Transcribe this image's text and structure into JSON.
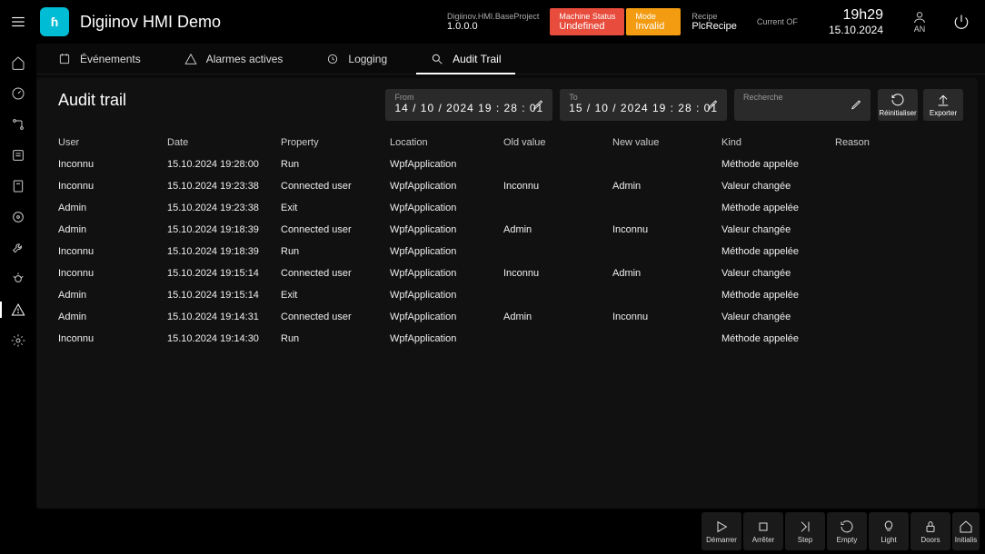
{
  "header": {
    "app_title": "Digiinov HMI Demo",
    "project_label": "Digiinov.HMI.BaseProject",
    "project_version": "1.0.0.0",
    "machine_status_label": "Machine Status",
    "machine_status_value": "Undefined",
    "mode_label": "Mode",
    "mode_value": "Invalid",
    "recipe_label": "Recipe",
    "recipe_value": "PlcRecipe",
    "current_of_label": "Current OF",
    "current_of_value": "",
    "time": "19h29",
    "date": "15.10.2024",
    "user": "AN"
  },
  "tabs": {
    "events": "Événements",
    "alarms": "Alarmes actives",
    "logging": "Logging",
    "audit": "Audit Trail"
  },
  "page": {
    "title": "Audit trail"
  },
  "filters": {
    "from_label": "From",
    "from_value": "14 / 10 / 2024   19 : 28 : 01",
    "to_label": "To",
    "to_value": "15 / 10 / 2024   19 : 28 : 01",
    "search_label": "Recherche",
    "search_value": "",
    "reset": "Réinitialiser",
    "export": "Exporter"
  },
  "columns": {
    "user": "User",
    "date": "Date",
    "property": "Property",
    "location": "Location",
    "old": "Old value",
    "new": "New value",
    "kind": "Kind",
    "reason": "Reason"
  },
  "rows": [
    {
      "user": "Inconnu",
      "date": "15.10.2024 19:28:00",
      "property": "Run",
      "location": "WpfApplication",
      "old": "",
      "new": "",
      "kind": "Méthode appelée",
      "reason": ""
    },
    {
      "user": "Inconnu",
      "date": "15.10.2024 19:23:38",
      "property": "Connected user",
      "location": "WpfApplication",
      "old": "Inconnu",
      "new": "Admin",
      "kind": "Valeur changée",
      "reason": ""
    },
    {
      "user": "Admin",
      "date": "15.10.2024 19:23:38",
      "property": "Exit",
      "location": "WpfApplication",
      "old": "",
      "new": "",
      "kind": "Méthode appelée",
      "reason": ""
    },
    {
      "user": "Admin",
      "date": "15.10.2024 19:18:39",
      "property": "Connected user",
      "location": "WpfApplication",
      "old": "Admin",
      "new": "Inconnu",
      "kind": "Valeur changée",
      "reason": ""
    },
    {
      "user": "Inconnu",
      "date": "15.10.2024 19:18:39",
      "property": "Run",
      "location": "WpfApplication",
      "old": "",
      "new": "",
      "kind": "Méthode appelée",
      "reason": ""
    },
    {
      "user": "Inconnu",
      "date": "15.10.2024 19:15:14",
      "property": "Connected user",
      "location": "WpfApplication",
      "old": "Inconnu",
      "new": "Admin",
      "kind": "Valeur changée",
      "reason": ""
    },
    {
      "user": "Admin",
      "date": "15.10.2024 19:15:14",
      "property": "Exit",
      "location": "WpfApplication",
      "old": "",
      "new": "",
      "kind": "Méthode appelée",
      "reason": ""
    },
    {
      "user": "Admin",
      "date": "15.10.2024 19:14:31",
      "property": "Connected user",
      "location": "WpfApplication",
      "old": "Admin",
      "new": "Inconnu",
      "kind": "Valeur changée",
      "reason": ""
    },
    {
      "user": "Inconnu",
      "date": "15.10.2024 19:14:30",
      "property": "Run",
      "location": "WpfApplication",
      "old": "",
      "new": "",
      "kind": "Méthode appelée",
      "reason": ""
    }
  ],
  "footer": {
    "demarrer": "Démarrer",
    "arreter": "Arrêter",
    "step": "Step",
    "empty": "Empty",
    "light": "Light",
    "doors": "Doors",
    "initialis": "Initialis"
  }
}
